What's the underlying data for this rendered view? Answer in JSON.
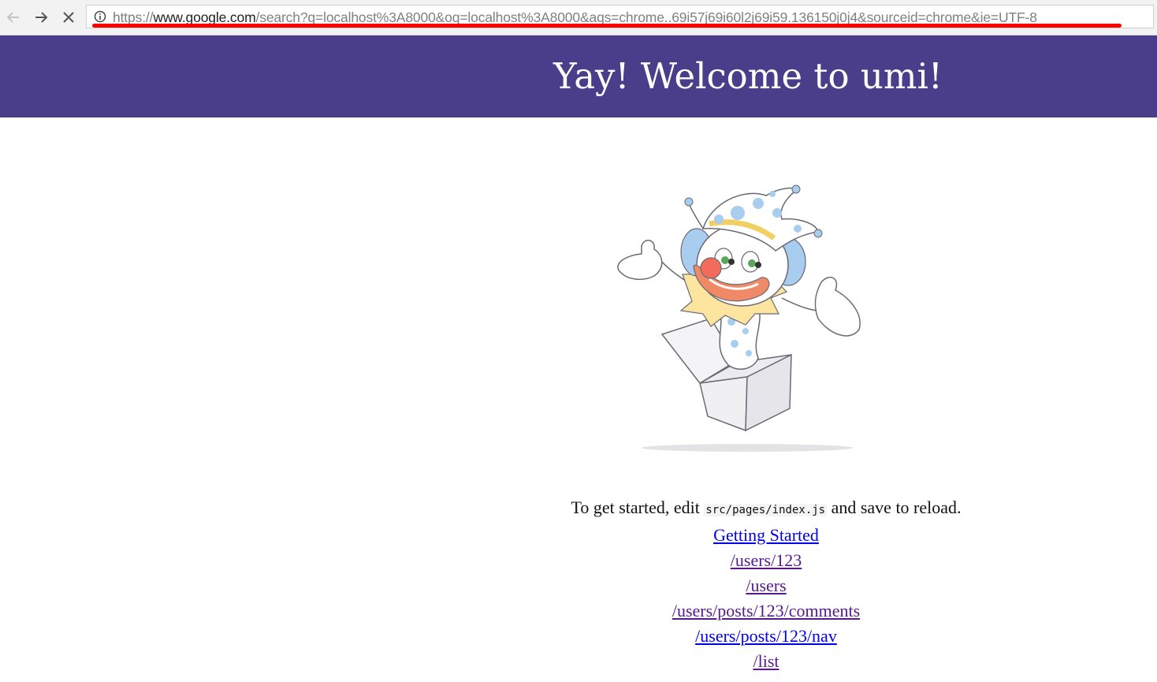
{
  "browser": {
    "url_scheme": "https://",
    "url_host": "www.google.com",
    "url_rest": "/search?q=localhost%3A8000&oq=localhost%3A8000&aqs=chrome..69i57j69i60l2j69i59.136150j0j4&sourceid=chrome&ie=UTF-8",
    "back_icon": "arrow-left-icon",
    "forward_icon": "arrow-right-icon",
    "stop_icon": "close-icon",
    "info_icon": "info-icon",
    "annotation_color": "#ff0000"
  },
  "banner": {
    "title": "Yay! Welcome to umi!",
    "background": "#4a3d8a"
  },
  "main": {
    "intro_before": "To get started, edit",
    "intro_code": "src/pages/index.js",
    "intro_after": "and save to reload.",
    "links": [
      {
        "label": "Getting Started"
      },
      {
        "label": "/users/123"
      },
      {
        "label": "/users"
      },
      {
        "label": "/users/posts/123/comments"
      },
      {
        "label": "/users/posts/123/nav"
      },
      {
        "label": "/list"
      }
    ]
  }
}
